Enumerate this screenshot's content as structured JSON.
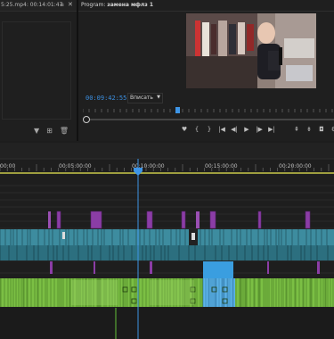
{
  "source_monitor": {
    "title": "5:25.mp4: 00:14:01:47",
    "menu_icon": "menu-lines-icon",
    "close_label": "✕",
    "tools": [
      "filter-icon",
      "new-item-icon",
      "trash-icon"
    ]
  },
  "program_monitor": {
    "title_prefix": "Program:",
    "sequence_name": "замена мфлз 1",
    "menu_icon": "menu-lines-icon",
    "timecode": "00:09:42:55",
    "zoom_label": "Вписать",
    "controls": [
      "marker-icon",
      "mark-in-icon",
      "mark-out-icon",
      "go-to-in-icon",
      "step-back-icon",
      "play-icon",
      "step-forward-icon",
      "go-to-out-icon"
    ],
    "right_controls": [
      "lift-icon",
      "extract-icon",
      "export-frame-icon",
      "settings-icon"
    ]
  },
  "timeline": {
    "timecodes": [
      "00:00",
      "00:05:00:00",
      "00:10:00:00",
      "00:15:00:00",
      "00:20:00:00"
    ],
    "playhead_time": "00:09:42:55"
  },
  "colors": {
    "playhead": "#3e95e6",
    "clip_teal": "#3d8c9f",
    "clip_purple": "#8b3da6",
    "clip_audio_green": "#7bbf44",
    "clip_selected_blue": "#3a9ee0",
    "work_area": "#c8c84a"
  }
}
